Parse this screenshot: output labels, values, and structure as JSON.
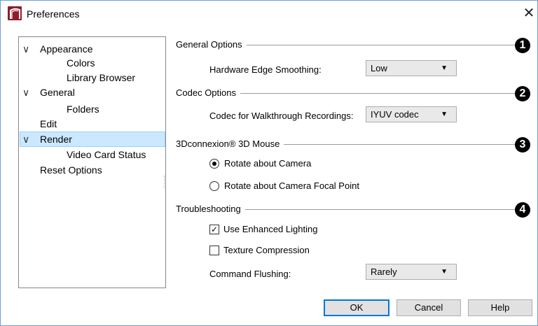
{
  "window": {
    "title": "Preferences",
    "close_glyph": "✕",
    "app_icon": "chief-architect-icon"
  },
  "tree": {
    "items": [
      {
        "label": "Appearance",
        "level": 0,
        "expanded": true
      },
      {
        "label": "Colors",
        "level": 1
      },
      {
        "label": "Library Browser",
        "level": 1
      },
      {
        "label": "General",
        "level": 0,
        "expanded": true
      },
      {
        "label": "Folders",
        "level": 1
      },
      {
        "label": "Edit",
        "level": 0
      },
      {
        "label": "Render",
        "level": 0,
        "expanded": true,
        "selected": true
      },
      {
        "label": "Video Card Status",
        "level": 1
      },
      {
        "label": "Reset Options",
        "level": 0
      }
    ],
    "expand_glyph": "∨"
  },
  "sections": {
    "general": {
      "title": "General Options",
      "badge": "1",
      "hw_edge_label": "Hardware Edge Smoothing:",
      "hw_edge_value": "Low"
    },
    "codec": {
      "title": "Codec Options",
      "badge": "2",
      "codec_label": "Codec for Walkthrough Recordings:",
      "codec_value": "IYUV codec"
    },
    "mouse": {
      "title": "3Dconnexion® 3D Mouse",
      "badge": "3",
      "option1": "Rotate about Camera",
      "option2": "Rotate about Camera Focal Point",
      "selected_option": 1
    },
    "troubleshooting": {
      "title": "Troubleshooting",
      "badge": "4",
      "enhanced_lighting_label": "Use Enhanced Lighting",
      "enhanced_lighting_checked": true,
      "texture_compression_label": "Texture Compression",
      "texture_compression_checked": false,
      "flushing_label": "Command Flushing:",
      "flushing_value": "Rarely"
    }
  },
  "buttons": {
    "ok": "OK",
    "cancel": "Cancel",
    "help": "Help"
  },
  "glyphs": {
    "dropdown_arrow": "▼",
    "check": "✓"
  },
  "colors": {
    "selection_bg": "#cce8ff",
    "selection_border": "#99d1ff",
    "default_button_border": "#0078d7",
    "app_icon": "#8e1e2a"
  }
}
